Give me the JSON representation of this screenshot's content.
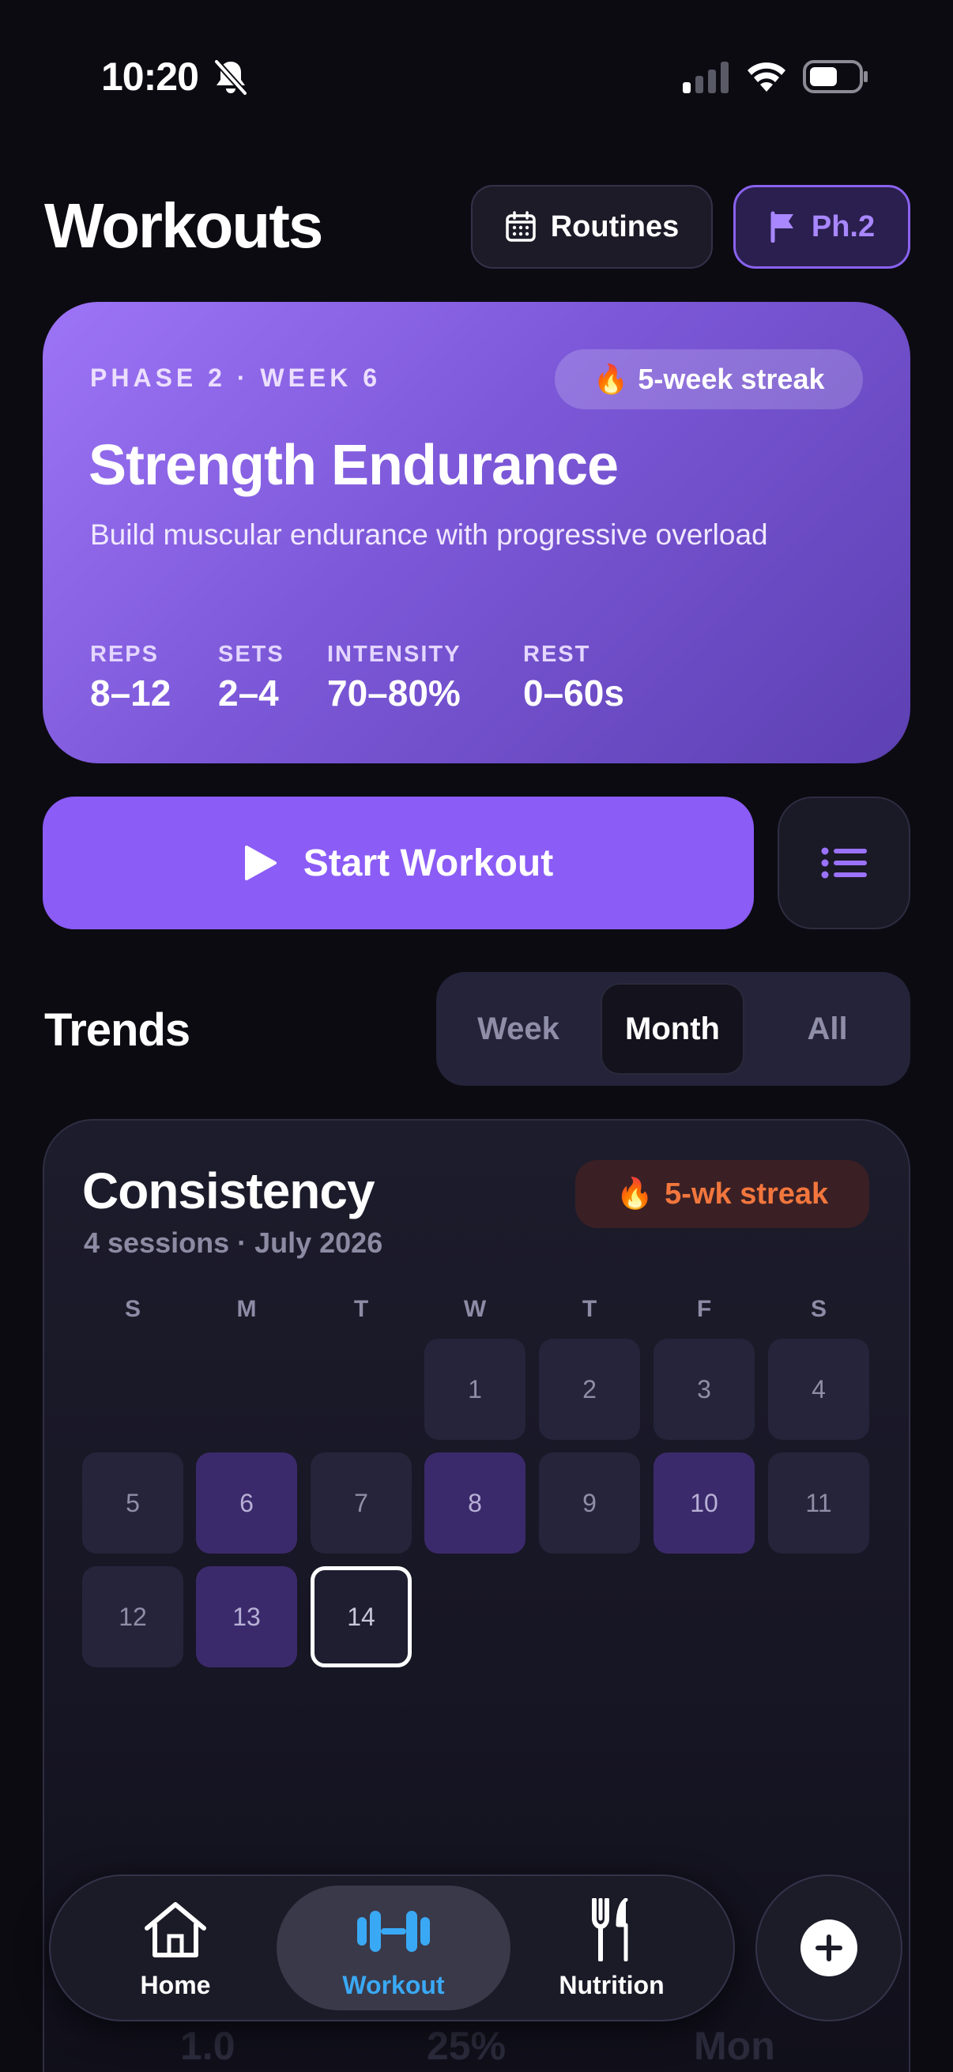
{
  "status_bar": {
    "time": "10:20"
  },
  "header": {
    "title": "Workouts",
    "routines_label": "Routines",
    "phase_label": "Ph.2"
  },
  "phase_card": {
    "eyebrow": "PHASE 2 · WEEK 6",
    "streak": "5-week streak",
    "title": "Strength Endurance",
    "description": "Build muscular endurance with progressive overload",
    "metrics": [
      {
        "label": "REPS",
        "value": "8–12"
      },
      {
        "label": "SETS",
        "value": "2–4"
      },
      {
        "label": "INTENSITY",
        "value": "70–80%"
      },
      {
        "label": "REST",
        "value": "0–60s"
      }
    ]
  },
  "start_button_label": "Start Workout",
  "trends": {
    "title": "Trends",
    "ranges": [
      "Week",
      "Month",
      "All"
    ],
    "selected_range": "Month"
  },
  "consistency": {
    "title": "Consistency",
    "subtitle": "4 sessions · July 2026",
    "streak": "5-wk streak",
    "weekdays": [
      "S",
      "M",
      "T",
      "W",
      "T",
      "F",
      "S"
    ],
    "days": [
      "1",
      "2",
      "3",
      "4",
      "5",
      "6",
      "7",
      "8",
      "9",
      "10",
      "11",
      "12",
      "13",
      "14"
    ],
    "completed_days": [
      "6",
      "8",
      "10",
      "13"
    ],
    "today": "14",
    "colors": {
      "completed": "#3b2a6b",
      "empty": "#25243a"
    }
  },
  "faded_stats": [
    "1.0",
    "25%",
    "Mon"
  ],
  "tabbar": {
    "tabs": [
      {
        "label": "Home",
        "icon": "house-icon"
      },
      {
        "label": "Workout",
        "icon": "dumbbell-icon"
      },
      {
        "label": "Nutrition",
        "icon": "fork-knife-icon"
      }
    ],
    "active": "Workout",
    "add_icon": "plus-icon"
  },
  "colors": {
    "accent": "#8b5cf6",
    "active_tab": "#3aa9f5",
    "streak_orange": "#f2763d"
  }
}
